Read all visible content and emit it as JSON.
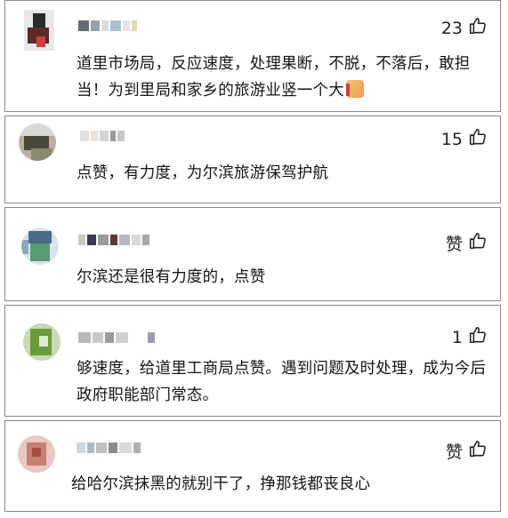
{
  "comments": [
    {
      "likes": "23",
      "text": "道里市场局，反应速度，处理果断，不脱，不落后，敢担当！为到里局和家乡的旅游业竖一个大",
      "has_emoji": true
    },
    {
      "likes": "15",
      "text": "点赞，有力度，为尔滨旅游保驾护航"
    },
    {
      "likes": "赞",
      "text": "尔滨还是很有力度的，点赞"
    },
    {
      "likes": "1",
      "text": "够速度，给道里工商局点赞。遇到问题及时处理，成为今后政府职能部门常态。"
    },
    {
      "likes": "赞",
      "text": "给哈尔滨抹黑的就别干了，挣那钱都丧良心"
    }
  ],
  "icons": {
    "like": "thumbs-up-icon"
  },
  "colors": {
    "border": "#8a8a8a",
    "text": "#151515"
  }
}
